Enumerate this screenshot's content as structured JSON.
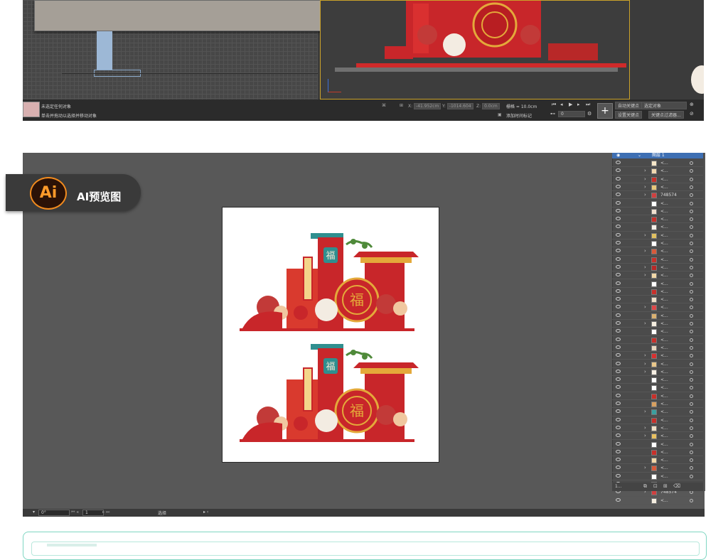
{
  "max_status": {
    "line1": "未选定任何对象",
    "line2": "单击并拖动以选择并移动对象",
    "x_label": "X:",
    "x_value": "-41.952cm",
    "y_label": "Y:",
    "y_value": "-1014.604",
    "z_label": "Z:",
    "z_value": "0.0cm",
    "grid": "栅格 = 10.0cm",
    "add_time_tag": "添加时间标记",
    "auto_key": "自动关键点",
    "set_key": "设置关键点",
    "selected_object": "选定对象",
    "key_filter": "关键点过滤器...",
    "frame_value": "0"
  },
  "ai_badge": {
    "logo": "Ai",
    "label": "AI预览图"
  },
  "layers": {
    "header_label": "图层 1",
    "rows": [
      {
        "name": "<...",
        "arrow": "",
        "color": "#f5e6c8"
      },
      {
        "name": "<...",
        "arrow": "›",
        "color": "#f0d8b0"
      },
      {
        "name": "<...",
        "arrow": "›",
        "color": "#c8302a"
      },
      {
        "name": "<...",
        "arrow": "›",
        "color": "#e8c87a"
      },
      {
        "name": "748574",
        "arrow": "›",
        "color": "#d04040"
      },
      {
        "name": "<...",
        "arrow": "",
        "color": "#ffffff"
      },
      {
        "name": "<...",
        "arrow": "",
        "color": "#f0e0d0"
      },
      {
        "name": "<...",
        "arrow": "",
        "color": "#c8302a"
      },
      {
        "name": "<...",
        "arrow": "",
        "color": "#f5f0e8"
      },
      {
        "name": "<...",
        "arrow": "›",
        "color": "#e0c060"
      },
      {
        "name": "<...",
        "arrow": "",
        "color": "#ffffff"
      },
      {
        "name": "<...",
        "arrow": "›",
        "color": "#d85a3a"
      },
      {
        "name": "<...",
        "arrow": "",
        "color": "#c8302a"
      },
      {
        "name": "<...",
        "arrow": "›",
        "color": "#b82828"
      },
      {
        "name": "<...",
        "arrow": "›",
        "color": "#f2d8a8"
      },
      {
        "name": "<...",
        "arrow": "",
        "color": "#ffffff"
      },
      {
        "name": "<...",
        "arrow": "",
        "color": "#c8302a"
      },
      {
        "name": "<...",
        "arrow": "",
        "color": "#f0e0c8"
      },
      {
        "name": "<...",
        "arrow": "›",
        "color": "#e04848"
      },
      {
        "name": "<...",
        "arrow": "",
        "color": "#d9b070"
      },
      {
        "name": "<...",
        "arrow": "›",
        "color": "#f5eee0"
      },
      {
        "name": "<...",
        "arrow": "",
        "color": "#ffffff"
      },
      {
        "name": "<...",
        "arrow": "",
        "color": "#c8302a"
      },
      {
        "name": "<...",
        "arrow": "",
        "color": "#e8d8c0"
      },
      {
        "name": "<...",
        "arrow": "›",
        "color": "#d83030"
      },
      {
        "name": "<...",
        "arrow": "›",
        "color": "#e9c78a"
      },
      {
        "name": "<...",
        "arrow": "›",
        "color": "#f7f0e4"
      },
      {
        "name": "<...",
        "arrow": "",
        "color": "#ffffff"
      },
      {
        "name": "<...",
        "arrow": "",
        "color": "#ffffff"
      },
      {
        "name": "<...",
        "arrow": "",
        "color": "#c8302a"
      },
      {
        "name": "<...",
        "arrow": "",
        "color": "#d8a060"
      },
      {
        "name": "<...",
        "arrow": "›",
        "color": "#3aa0a0"
      },
      {
        "name": "<...",
        "arrow": "",
        "color": "#c8302a"
      },
      {
        "name": "<...",
        "arrow": "›",
        "color": "#f0e0c8"
      },
      {
        "name": "<...",
        "arrow": "›",
        "color": "#e8c060"
      },
      {
        "name": "<...",
        "arrow": "",
        "color": "#ffffff"
      },
      {
        "name": "<...",
        "arrow": "",
        "color": "#c8302a"
      },
      {
        "name": "<...",
        "arrow": "",
        "color": "#f2d8a8"
      },
      {
        "name": "<...",
        "arrow": "›",
        "color": "#d85a3a"
      },
      {
        "name": "<...",
        "arrow": "",
        "color": "#ffffff"
      },
      {
        "name": "<...",
        "arrow": "",
        "color": "#c8302a"
      },
      {
        "name": "748574",
        "arrow": "›",
        "color": "#d04040"
      },
      {
        "name": "<...",
        "arrow": "",
        "color": "#f5eee0"
      }
    ],
    "footer_label": "1..."
  },
  "ai_status": {
    "zoom": "0°",
    "page": "1",
    "tool": "选择"
  },
  "colors": {
    "red": "#c8262a",
    "gold": "#e4a93a",
    "teal": "#2f8f8f",
    "cream": "#f6ead6",
    "green": "#4f8a3a"
  }
}
